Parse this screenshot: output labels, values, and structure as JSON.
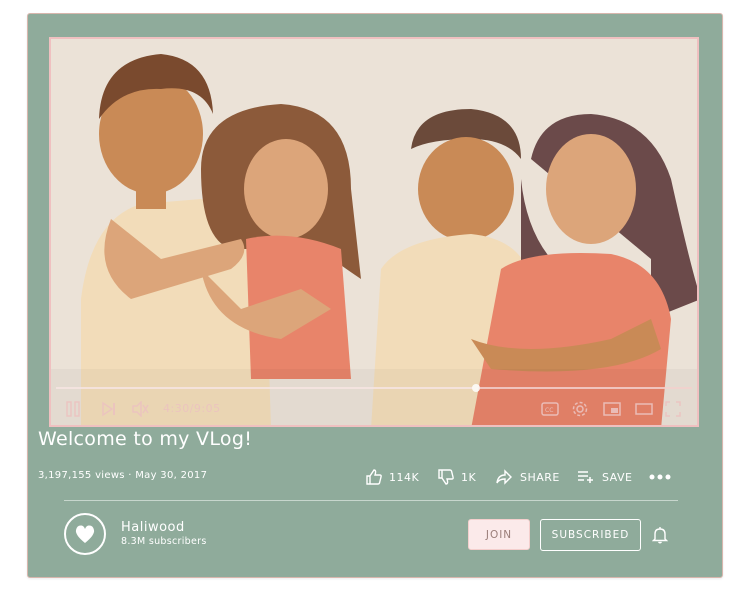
{
  "player": {
    "time": "4:30/9:05",
    "progress": 0.66,
    "colors": {
      "frame": "#8fab9b",
      "video_bg": "#ebe2d7",
      "controls": "#ecc3c0"
    }
  },
  "video": {
    "title": "Welcome to my VLog!",
    "meta": "3,197,155 views · May 30, 2017"
  },
  "actions": {
    "likes": "114K",
    "dislikes": "1K",
    "share": "SHARE",
    "save": "SAVE"
  },
  "channel": {
    "name": "Haliwood",
    "subscribers": "8.3M subscribers",
    "join_label": "JOIN",
    "subscribed_label": "SUBSCRIBED"
  }
}
